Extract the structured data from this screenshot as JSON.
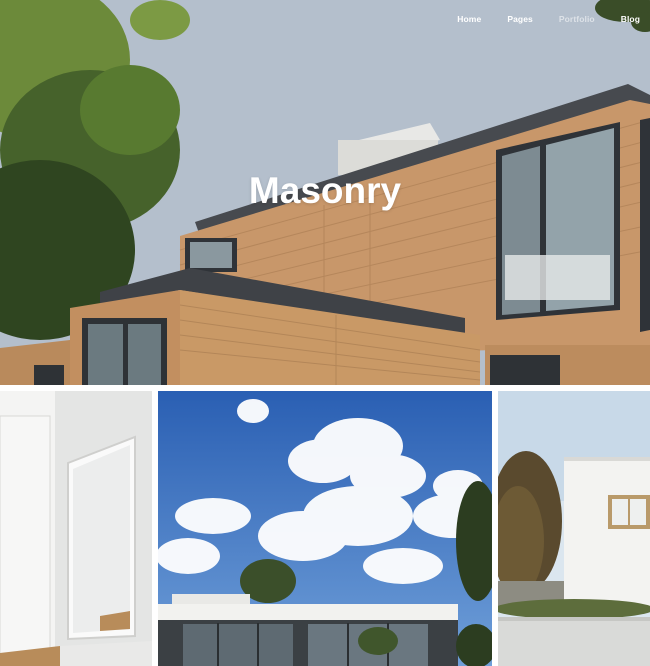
{
  "header": {
    "nav": [
      {
        "label": "Home",
        "active": false
      },
      {
        "label": "Pages",
        "active": false
      },
      {
        "label": "Portfolio",
        "active": true
      },
      {
        "label": "Blog",
        "active": false
      }
    ]
  },
  "hero": {
    "title": "Masonry"
  },
  "gallery": {
    "items": [
      {
        "subject": "white interior hallway with mirror"
      },
      {
        "subject": "flat-roof villa under cloudy blue sky"
      },
      {
        "subject": "white cube house with trees"
      }
    ]
  },
  "colors": {
    "sky": "#b3bfcd",
    "wood": "#c99966",
    "roof": "#4a4d52",
    "nav_text": "#ffffff"
  }
}
